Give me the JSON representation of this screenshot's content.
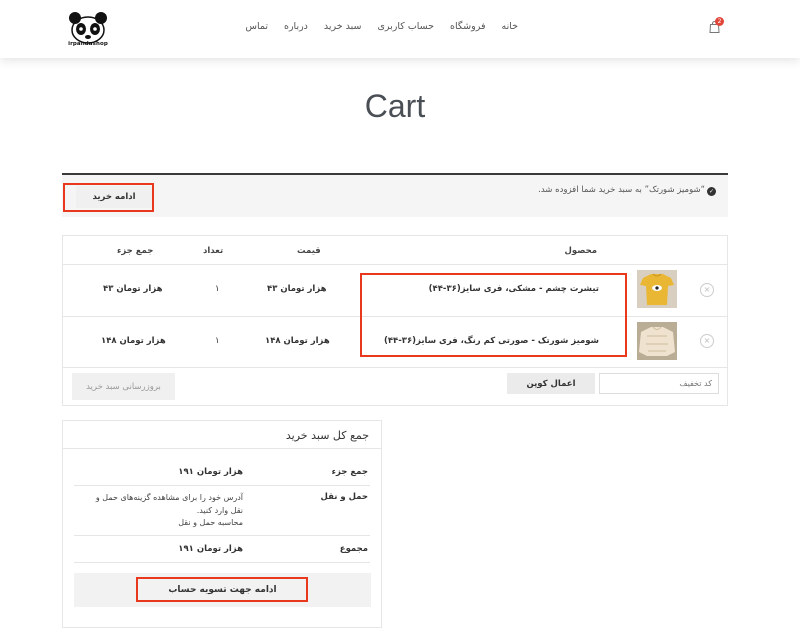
{
  "header": {
    "logo_text": "irpandashop",
    "nav": [
      "خانه",
      "فروشگاه",
      "حساب کاربری",
      "سبد خرید",
      "درباره",
      "تماس"
    ],
    "cart_count": "2",
    "icons": {
      "cart": "shopping-bag-icon",
      "logo": "panda-logo-icon"
    }
  },
  "page": {
    "title": "Cart"
  },
  "notice": {
    "message": "“شومیز شورتک” به سبد خرید شما افزوده شد.",
    "continue_label": "ادامه خرید"
  },
  "cart_table": {
    "headers": {
      "product": "محصول",
      "price": "قیمت",
      "qty": "تعداد",
      "subtotal": "جمع جزء"
    },
    "rows": [
      {
        "name": "تیشرت چشم - مشکی، فری سایز(۳۶-۴۴)",
        "price": "۴۳ هزار تومان",
        "qty": "۱",
        "subtotal": "۴۳ هزار تومان",
        "remove": "×"
      },
      {
        "name": "شومیز شورتک - صورتی کم رنگ، فری سایز(۳۶-۴۴)",
        "price": "۱۴۸ هزار تومان",
        "qty": "۱",
        "subtotal": "۱۴۸ هزار تومان",
        "remove": "×"
      }
    ],
    "coupon_placeholder": "کد تخفیف",
    "apply_coupon": "اعمال کوپن",
    "update_cart": "بروزرسانی سبد خرید"
  },
  "totals": {
    "title": "جمع کل سبد خرید",
    "subtotal_label": "جمع جزء",
    "subtotal_value": "۱۹۱ هزار تومان",
    "shipping_label": "حمل و نقل",
    "shipping_text_1": "آدرس خود را برای مشاهده گزینه‌های حمل و",
    "shipping_text_2": "نقل وارد کنید.",
    "shipping_calc": "محاسبه حمل و نقل",
    "total_label": "مجموع",
    "total_value": "۱۹۱ هزار تومان",
    "checkout": "ادامه جهت تسویه حساب"
  },
  "colors": {
    "highlight": "#e8391f",
    "badge": "#e0463a",
    "title": "#4a4f55"
  }
}
